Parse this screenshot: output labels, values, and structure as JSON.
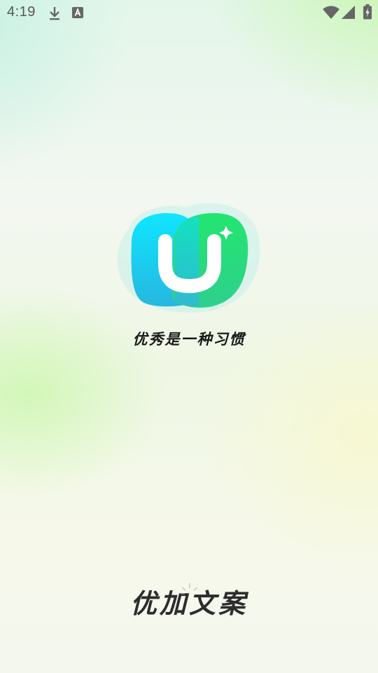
{
  "status_bar": {
    "time": "4:19",
    "icons": [
      "download-icon",
      "a-icon",
      "wifi-icon",
      "signal-icon",
      "battery-icon"
    ]
  },
  "splash": {
    "logo": "app-logo",
    "slogan": "优秀是一种习惯",
    "brand_name": "优加文案"
  },
  "colors": {
    "logo_blue": "#18d8f0",
    "logo_green": "#2ee07a",
    "text": "#1a1a1a"
  }
}
